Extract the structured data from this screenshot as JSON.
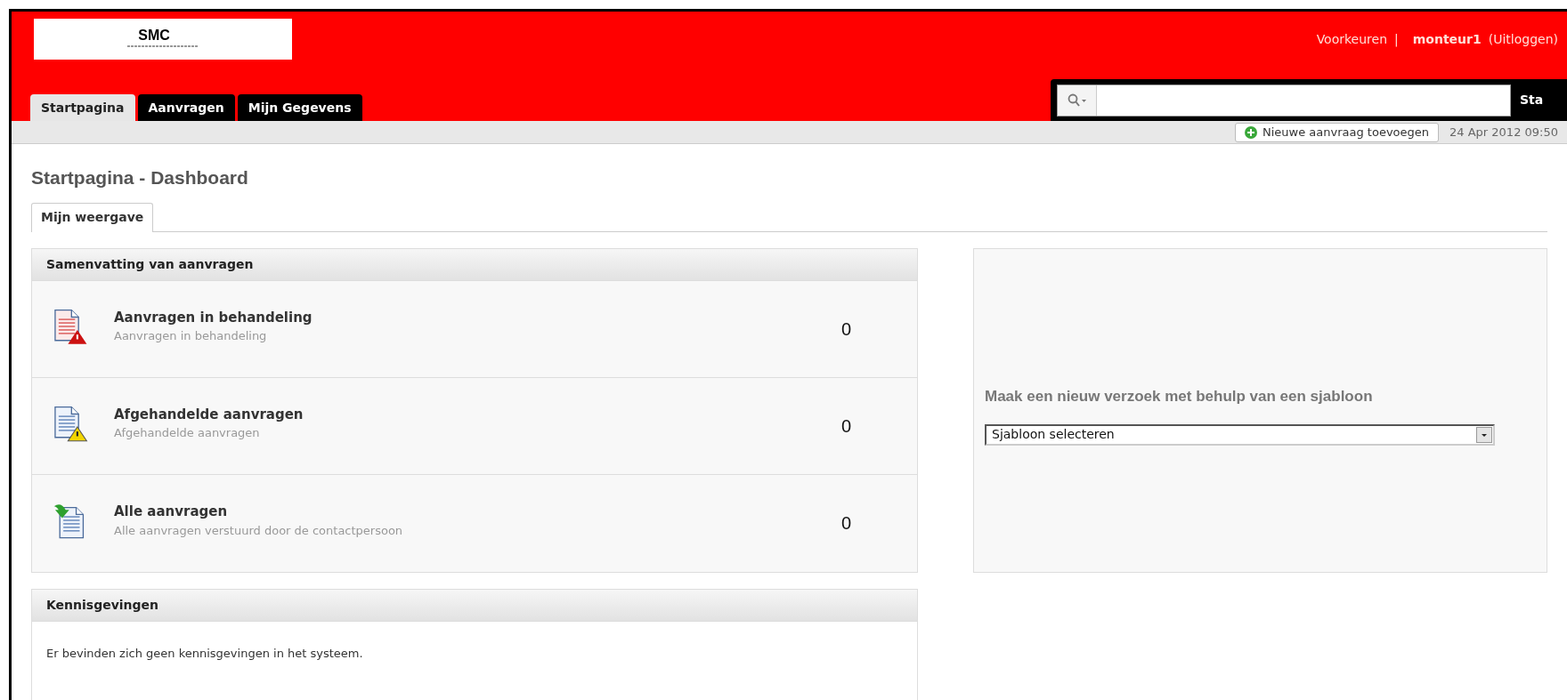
{
  "header": {
    "logo": "SMC",
    "links": [
      {
        "kind": "link",
        "label": "Voorkeuren"
      },
      {
        "kind": "separator",
        "label": "|"
      },
      {
        "kind": "user",
        "label": "monteur1"
      },
      {
        "kind": "link",
        "label": "(Uitloggen)"
      }
    ]
  },
  "tabs": [
    {
      "label": "Startpagina",
      "selected": true
    },
    {
      "label": "Aanvragen",
      "selected": false
    },
    {
      "label": "Mijn Gegevens",
      "selected": false
    }
  ],
  "search": {
    "button": "Sta"
  },
  "toolbar": {
    "add_button": "Nieuwe aanvraag toevoegen",
    "datetime": "24 Apr 2012 09:50"
  },
  "page_title": "Startpagina - Dashboard",
  "view_tabs": [
    {
      "label": "Mijn weergave",
      "selected": true
    }
  ],
  "summary": {
    "title": "Samenvatting van aanvragen",
    "rows": [
      {
        "kind": "pending",
        "title": "Aanvragen in behandeling",
        "subtitle": "Aanvragen in behandeling",
        "count": "0"
      },
      {
        "kind": "handled",
        "title": "Afgehandelde aanvragen",
        "subtitle": "Afgehandelde aanvragen",
        "count": "0"
      },
      {
        "kind": "all",
        "title": "Alle aanvragen",
        "subtitle": "Alle aanvragen verstuurd door de contactpersoon",
        "count": "0"
      }
    ]
  },
  "notifications": {
    "title": "Kennisgevingen",
    "message": "Er bevinden zich geen kennisgevingen in het systeem."
  },
  "template": {
    "heading": "Maak een nieuw verzoek met behulp van een sjabloon",
    "select_value": "Sjabloon selecteren"
  }
}
